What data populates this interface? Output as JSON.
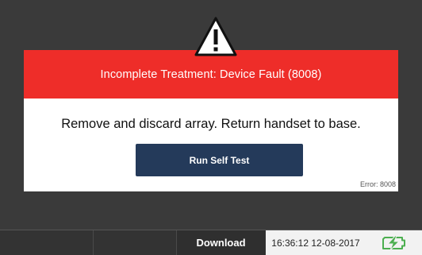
{
  "dialog": {
    "title": "Incomplete Treatment: Device Fault (8008)",
    "message": "Remove and discard array. Return handset to base.",
    "button_label": "Run Self Test",
    "error_code": "Error: 8008",
    "header_color": "#ee2d29",
    "button_color": "#243a5a"
  },
  "status_bar": {
    "download_label": "Download",
    "datetime": "16:36:12  12-08-2017",
    "battery_icon": "battery-charging-icon",
    "battery_color": "#4caf50"
  },
  "icons": {
    "warning": "warning-triangle-icon"
  }
}
